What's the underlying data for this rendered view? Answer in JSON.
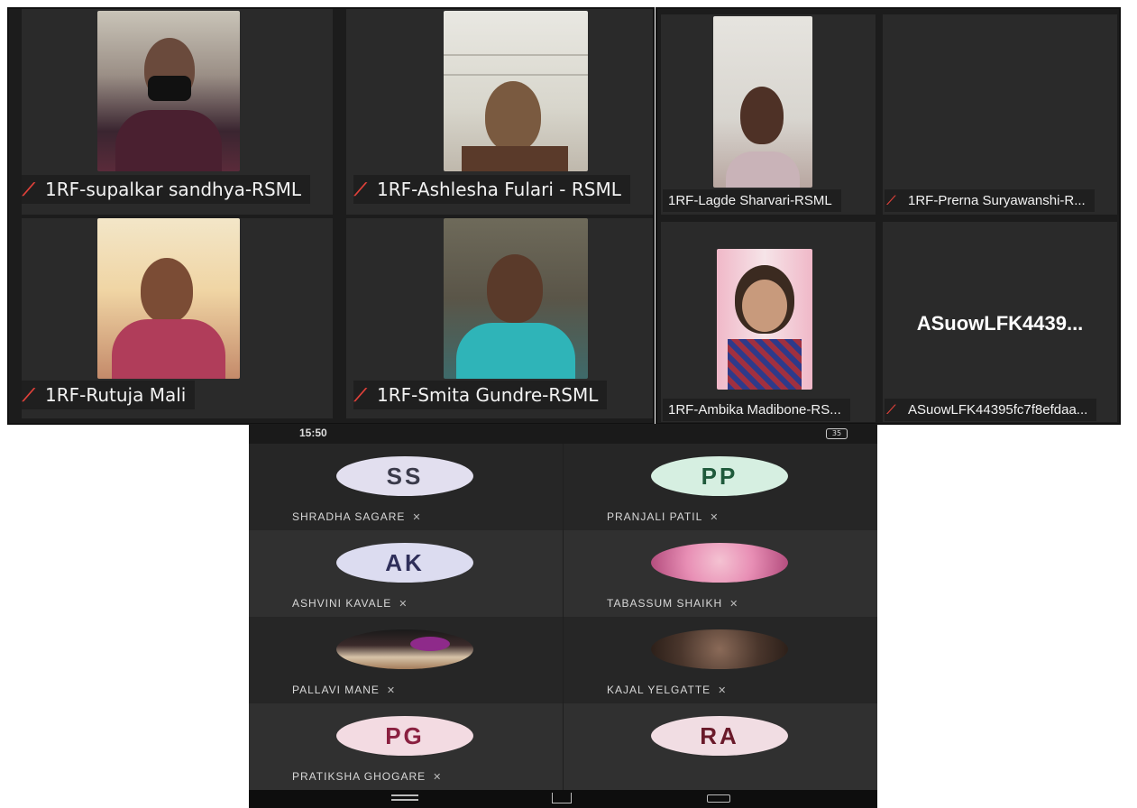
{
  "panel_left": {
    "tiles": [
      {
        "name": "1RF-supalkar sandhya-RSML",
        "muted": true
      },
      {
        "name": "1RF-Ashlesha Fulari - RSML",
        "muted": true
      },
      {
        "name": "1RF-Rutuja Mali",
        "muted": true
      },
      {
        "name": "1RF-Smita Gundre-RSML",
        "muted": true
      }
    ]
  },
  "panel_right": {
    "tiles": [
      {
        "name": "1RF-Lagde Sharvari-RSML",
        "muted": false
      },
      {
        "name": "1RF-Prerna Suryawanshi-R...",
        "muted": true
      },
      {
        "name": "1RF-Ambika Madibone-RS...",
        "muted": false
      },
      {
        "name": "ASuowLFK44395fc7f8efdaa...",
        "muted": true,
        "placeholder": "ASuowLFK4439..."
      }
    ]
  },
  "phone": {
    "status_time": "15:50",
    "status_battery": "35",
    "participants": [
      {
        "initials": "SS",
        "name": "SHRADHA SAGARE",
        "color": "#e2dfef",
        "text": "#3a3a4a"
      },
      {
        "initials": "PP",
        "name": "PRANJALI PATIL",
        "color": "#d6efe1",
        "text": "#1f5a3b"
      },
      {
        "initials": "AK",
        "name": "ASHVINI KAVALE",
        "color": "#dcdcf0",
        "text": "#2f2f5a"
      },
      {
        "initials": "",
        "name": "TABASSUM SHAIKH",
        "color": "#e88fb5",
        "text": "#000"
      },
      {
        "initials": "",
        "name": "PALLAVI MANE",
        "color": "#3b2a2a",
        "text": "#fff"
      },
      {
        "initials": "",
        "name": "KAJAL YELGATTE",
        "color": "#5b4a40",
        "text": "#fff"
      },
      {
        "initials": "PG",
        "name": "PRATIKSHA GHOGARE",
        "color": "#f3dbe2",
        "text": "#8a2040"
      },
      {
        "initials": "RA",
        "name": "",
        "color": "#f1dde3",
        "text": "#6a1a2a"
      }
    ]
  },
  "colors": {
    "mute": "#e0413a",
    "tile_bg": "#2a2a2a"
  }
}
